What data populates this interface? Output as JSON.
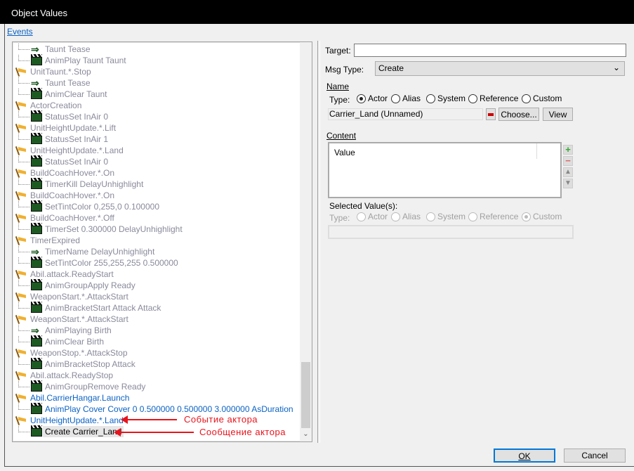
{
  "window": {
    "title": "Object Values"
  },
  "events_link": "Events",
  "tree": [
    {
      "kind": "msg",
      "icon": "arrow",
      "text": "Taunt Tease",
      "style": "gray"
    },
    {
      "kind": "msg",
      "icon": "clapper",
      "text": "AnimPlay Taunt Taunt",
      "style": "gray"
    },
    {
      "kind": "ev",
      "icon": "flag",
      "text": "UnitTaunt.*.Stop",
      "style": "gray"
    },
    {
      "kind": "msg",
      "icon": "arrow",
      "text": "Taunt Tease",
      "style": "gray"
    },
    {
      "kind": "msg",
      "icon": "clapper",
      "text": "AnimClear Taunt",
      "style": "gray"
    },
    {
      "kind": "ev",
      "icon": "flag",
      "text": "ActorCreation",
      "style": "gray"
    },
    {
      "kind": "msg",
      "icon": "clapper",
      "text": "StatusSet InAir 0",
      "style": "gray"
    },
    {
      "kind": "ev",
      "icon": "flag",
      "text": "UnitHeightUpdate.*.Lift",
      "style": "gray"
    },
    {
      "kind": "msg",
      "icon": "clapper",
      "text": "StatusSet InAir 1",
      "style": "gray"
    },
    {
      "kind": "ev",
      "icon": "flag",
      "text": "UnitHeightUpdate.*.Land",
      "style": "gray"
    },
    {
      "kind": "msg",
      "icon": "clapper",
      "text": "StatusSet InAir 0",
      "style": "gray"
    },
    {
      "kind": "ev",
      "icon": "flag",
      "text": "BuildCoachHover.*.On",
      "style": "gray"
    },
    {
      "kind": "msg",
      "icon": "clapper",
      "text": "TimerKill DelayUnhighlight",
      "style": "gray"
    },
    {
      "kind": "ev",
      "icon": "flag",
      "text": "BuildCoachHover.*.On",
      "style": "gray"
    },
    {
      "kind": "msg",
      "icon": "clapper",
      "text": "SetTintColor 0,255,0 0.100000",
      "style": "gray"
    },
    {
      "kind": "ev",
      "icon": "flag",
      "text": "BuildCoachHover.*.Off",
      "style": "gray"
    },
    {
      "kind": "msg",
      "icon": "clapper",
      "text": "TimerSet 0.300000 DelayUnhighlight",
      "style": "gray"
    },
    {
      "kind": "ev",
      "icon": "flag",
      "text": "TimerExpired",
      "style": "gray"
    },
    {
      "kind": "msg",
      "icon": "arrow",
      "text": "TimerName DelayUnhighlight",
      "style": "gray"
    },
    {
      "kind": "msg",
      "icon": "clapper",
      "text": "SetTintColor 255,255,255 0.500000",
      "style": "gray"
    },
    {
      "kind": "ev",
      "icon": "flag",
      "text": "Abil.attack.ReadyStart",
      "style": "gray"
    },
    {
      "kind": "msg",
      "icon": "clapper",
      "text": "AnimGroupApply Ready",
      "style": "gray"
    },
    {
      "kind": "ev",
      "icon": "flag",
      "text": "WeaponStart.*.AttackStart",
      "style": "gray"
    },
    {
      "kind": "msg",
      "icon": "clapper",
      "text": "AnimBracketStart Attack Attack",
      "style": "gray"
    },
    {
      "kind": "ev",
      "icon": "flag",
      "text": "WeaponStart.*.AttackStart",
      "style": "gray"
    },
    {
      "kind": "msg",
      "icon": "arrow",
      "text": "AnimPlaying Birth",
      "style": "gray"
    },
    {
      "kind": "msg",
      "icon": "clapper",
      "text": "AnimClear Birth",
      "style": "gray"
    },
    {
      "kind": "ev",
      "icon": "flag",
      "text": "WeaponStop.*.AttackStop",
      "style": "gray"
    },
    {
      "kind": "msg",
      "icon": "clapper",
      "text": "AnimBracketStop Attack",
      "style": "gray"
    },
    {
      "kind": "ev",
      "icon": "flag",
      "text": "Abil.attack.ReadyStop",
      "style": "gray"
    },
    {
      "kind": "msg",
      "icon": "clapper",
      "text": "AnimGroupRemove Ready",
      "style": "gray"
    },
    {
      "kind": "ev",
      "icon": "flag",
      "text": "Abil.CarrierHangar.Launch",
      "style": "blue"
    },
    {
      "kind": "msg",
      "icon": "clapper",
      "text": "AnimPlay Cover Cover 0 0.500000 0.500000 3.000000 AsDuration",
      "style": "blue"
    },
    {
      "kind": "ev",
      "icon": "flag",
      "text": "UnitHeightUpdate.*.Land",
      "style": "blue"
    },
    {
      "kind": "msg",
      "icon": "clapper",
      "text": "Create Carrier_Land",
      "style": "sel"
    }
  ],
  "annotations": {
    "event": "Событие актора",
    "message": "Сообщение актора"
  },
  "form": {
    "target_label": "Target:",
    "target_value": "",
    "msgtype_label": "Msg Type:",
    "msgtype_value": "Create",
    "name_section": "Name",
    "type_label": "Type:",
    "type_options": [
      "Actor",
      "Alias",
      "System",
      "Reference",
      "Custom"
    ],
    "type_selected": "Actor",
    "name_value": "Carrier_Land (Unnamed)",
    "choose_button": "Choose...",
    "view_button": "View",
    "content_section": "Content",
    "content_column": "Value",
    "selected_values_label": "Selected Value(s):",
    "selected_type_label": "Type:",
    "selected_type_selected": "Custom",
    "selected_value": ""
  },
  "buttons": {
    "ok": "OK",
    "cancel": "Cancel"
  }
}
